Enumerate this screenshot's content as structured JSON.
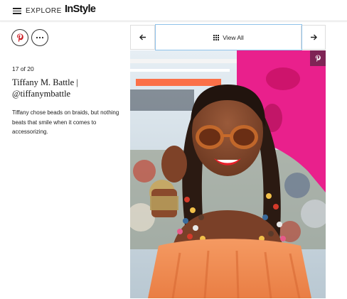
{
  "header": {
    "explore_label": "EXPLORE",
    "logo_text": "InStyle"
  },
  "share": {
    "pinterest_icon": "pinterest-icon",
    "more_icon": "more-horizontal-icon"
  },
  "slide": {
    "counter": "17 of 20",
    "title": "Tiffany M. Battle | @tiffanymbattle",
    "caption": "Tiffany chose beads on braids, but nothing beats that smile when it comes to accessorizing."
  },
  "nav": {
    "view_all_label": "View All",
    "prev_icon": "arrow-left-icon",
    "next_icon": "arrow-right-icon",
    "highlight_color": "#8fc2ea"
  },
  "colors": {
    "pinterest": "#cb2027",
    "backdrop_pink": "#e9208c",
    "top_orange": "#f08a54"
  }
}
